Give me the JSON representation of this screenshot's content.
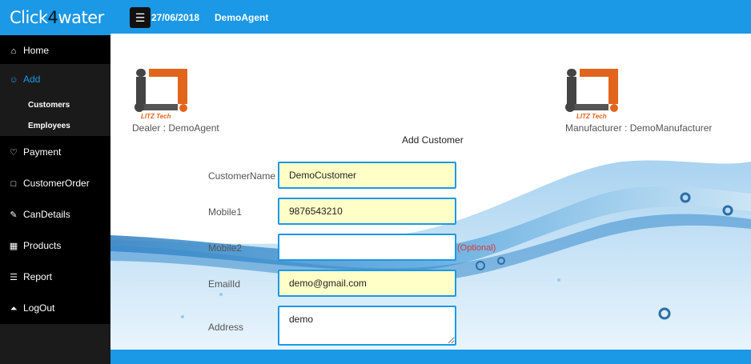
{
  "app": {
    "brand_prefix": "Click",
    "brand_four": "4",
    "brand_suffix": "water"
  },
  "header": {
    "menu_icon": "hamburger-icon",
    "date": "27/06/2018",
    "agent": "DemoAgent"
  },
  "sidebar": {
    "items": [
      {
        "label": "Home",
        "icon": "home-icon"
      },
      {
        "label": "Add",
        "icon": "users-icon"
      },
      {
        "label": "Payment",
        "icon": "heart-icon"
      },
      {
        "label": "CustomerOrder",
        "icon": "tablet-icon"
      },
      {
        "label": "CanDetails",
        "icon": "pencil-icon"
      },
      {
        "label": "Products",
        "icon": "grid-icon"
      },
      {
        "label": "Report",
        "icon": "list-icon"
      },
      {
        "label": "LogOut",
        "icon": "pin-icon"
      }
    ],
    "sub_items": [
      "Customers",
      "Employees"
    ]
  },
  "logos": {
    "left_tag": "LITZ Tech",
    "right_tag": "LITZ Tech",
    "dealer": "Dealer : DemoAgent",
    "manufacturer": "Manufacturer : DemoManufacturer"
  },
  "form": {
    "title": "Add Customer",
    "fields": [
      {
        "label": "CustomerName",
        "value": "DemoCustomer"
      },
      {
        "label": "Mobile1",
        "value": "9876543210"
      },
      {
        "label": "Mobile2",
        "value": ""
      },
      {
        "label": "EmailId",
        "value": "demo@gmail.com"
      },
      {
        "label": "Address",
        "value": "demo"
      }
    ],
    "optional_note": "(Optional)"
  },
  "colors": {
    "accent": "#1b98e6",
    "sidebar_bg": "#000000",
    "field_bg": "#ffffc8",
    "logo_orange": "#e3641c",
    "optional_red": "#d63a3a"
  }
}
